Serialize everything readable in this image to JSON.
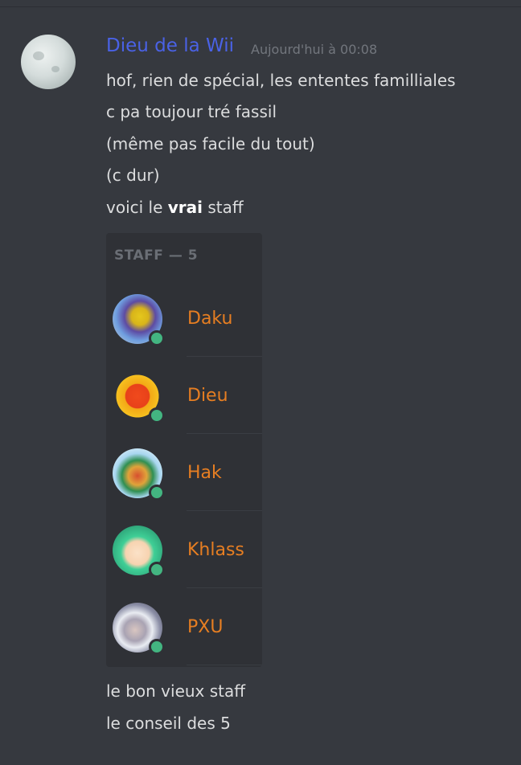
{
  "message": {
    "author": "Dieu de la Wii",
    "timestamp": "Aujourd'hui à 00:08",
    "lines": [
      "hof, rien de spécial, les ententes familliales",
      "c pa toujour tré fassil",
      "(même pas facile du tout)",
      "(c dur)"
    ],
    "line5_prefix": "voici le ",
    "line5_bold": "vrai",
    "line5_suffix": " staff",
    "after_lines": [
      "le bon vieux staff",
      "le conseil des 5"
    ]
  },
  "embed": {
    "header": "STAFF — 5",
    "members": [
      {
        "name": "Daku",
        "status": "online"
      },
      {
        "name": "Dieu",
        "status": "online"
      },
      {
        "name": "Hak",
        "status": "online"
      },
      {
        "name": "Khlass",
        "status": "online"
      },
      {
        "name": "PXU",
        "status": "online"
      }
    ],
    "name_color": "#e67e22",
    "online_color": "#43b581"
  },
  "colors": {
    "background": "#36393f",
    "author": "#4a62e6",
    "text": "#dcddde",
    "timestamp": "#72767d",
    "embed_bg": "#2f3136"
  }
}
